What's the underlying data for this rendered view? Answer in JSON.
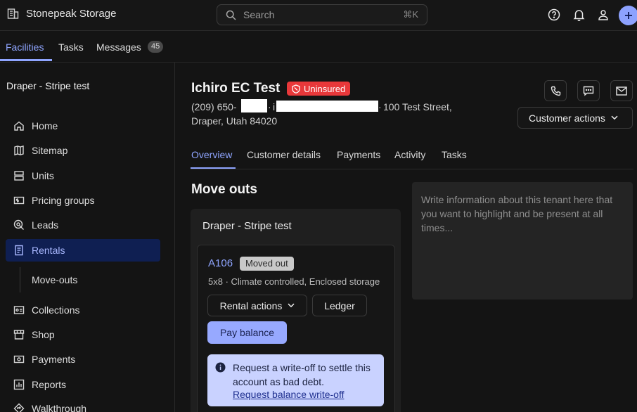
{
  "app": {
    "name": "Stonepeak Storage",
    "search_placeholder": "Search",
    "search_shortcut": "⌘K"
  },
  "topnav": {
    "tabs": [
      {
        "label": "Facilities",
        "active": true
      },
      {
        "label": "Tasks"
      },
      {
        "label": "Messages",
        "badge": "45"
      }
    ]
  },
  "sidebar": {
    "facility": "Draper - Stripe test",
    "items": [
      {
        "label": "Home",
        "icon": "home-icon"
      },
      {
        "label": "Sitemap",
        "icon": "map-icon"
      },
      {
        "label": "Units",
        "icon": "units-icon"
      },
      {
        "label": "Pricing groups",
        "icon": "pricing-icon"
      },
      {
        "label": "Leads",
        "icon": "leads-icon"
      },
      {
        "label": "Rentals",
        "icon": "rentals-icon",
        "active": true
      },
      {
        "label": "Collections",
        "icon": "collections-icon"
      },
      {
        "label": "Shop",
        "icon": "shop-icon"
      },
      {
        "label": "Payments",
        "icon": "payments-icon"
      },
      {
        "label": "Reports",
        "icon": "reports-icon"
      },
      {
        "label": "Walkthrough",
        "icon": "walkthrough-icon"
      }
    ],
    "subitem": "Move-outs"
  },
  "tenant": {
    "name": "Ichiro EC Test",
    "badge": "Uninsured",
    "phone_prefix": "(209) 650-",
    "address_line1": "100 Test Street,",
    "address_line2": "Draper, Utah 84020",
    "customer_actions": "Customer actions"
  },
  "tabs": [
    "Overview",
    "Customer details",
    "Payments",
    "Activity",
    "Tasks"
  ],
  "moveouts": {
    "title": "Move outs",
    "facility": "Draper - Stripe test",
    "unit": "A106",
    "status": "Moved out",
    "description": "5x8 · Climate controlled, Enclosed storage",
    "rental_actions": "Rental actions",
    "ledger": "Ledger",
    "pay_balance": "Pay balance",
    "info_text": "Request a write-off to settle this account as bad debt.",
    "info_link": "Request balance write-off"
  },
  "notes": {
    "placeholder": "Write information about this tenant here that you want to highlight and be present at all times..."
  },
  "colors": {
    "accent": "#8fa5ff",
    "danger": "#e8383a",
    "active_nav_bg": "#0f1f52"
  }
}
